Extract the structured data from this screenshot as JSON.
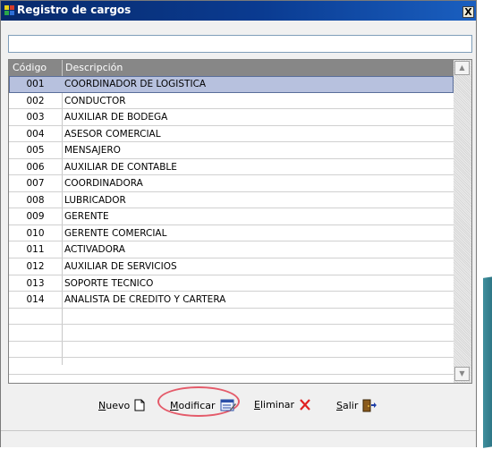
{
  "window": {
    "title": "Registro de cargos",
    "close_label": "X"
  },
  "search": {
    "value": "",
    "placeholder": ""
  },
  "grid": {
    "columns": [
      "Código",
      "Descripción"
    ],
    "selected_index": 0,
    "rows": [
      {
        "code": "001",
        "desc": "COORDINADOR DE LOGISTICA"
      },
      {
        "code": "002",
        "desc": "CONDUCTOR"
      },
      {
        "code": "003",
        "desc": "AUXILIAR DE BODEGA"
      },
      {
        "code": "004",
        "desc": "ASESOR COMERCIAL"
      },
      {
        "code": "005",
        "desc": "MENSAJERO"
      },
      {
        "code": "006",
        "desc": "AUXILIAR DE CONTABLE"
      },
      {
        "code": "007",
        "desc": "COORDINADORA"
      },
      {
        "code": "008",
        "desc": "LUBRICADOR"
      },
      {
        "code": "009",
        "desc": "GERENTE"
      },
      {
        "code": "010",
        "desc": "GERENTE COMERCIAL"
      },
      {
        "code": "011",
        "desc": "ACTIVADORA"
      },
      {
        "code": "012",
        "desc": "AUXILIAR DE SERVICIOS"
      },
      {
        "code": "013",
        "desc": "SOPORTE TECNICO"
      },
      {
        "code": "014",
        "desc": "ANALISTA DE CREDITO Y CARTERA"
      }
    ],
    "empty_rows": 4
  },
  "buttons": {
    "nuevo": {
      "label": "Nuevo",
      "icon": "new-document-icon"
    },
    "modificar": {
      "label": "Modificar",
      "icon": "edit-form-icon"
    },
    "eliminar": {
      "label": "Eliminar",
      "icon": "delete-x-icon",
      "color": "#e02020"
    },
    "salir": {
      "label": "Salir",
      "icon": "exit-door-icon"
    }
  },
  "colors": {
    "titlebar": "#0a3b91",
    "header": "#878787",
    "selection": "#b7c1de",
    "highlight": "#e45b6a"
  }
}
